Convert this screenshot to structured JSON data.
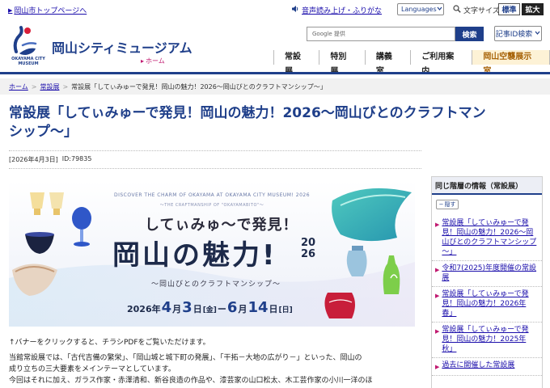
{
  "utility": {
    "home_link": "岡山市トップページへ",
    "voice_link": "音声読み上げ・ふりがな",
    "languages": "Languages",
    "font_size_label": "文字サイズ",
    "font_normal": "標準",
    "font_large": "拡大"
  },
  "header": {
    "logo_sub": "OKAYAMA CITY MUSEUM",
    "site_title": "岡山シティミュージアム",
    "site_home": "ホーム",
    "search_placeholder": "Google 提供",
    "search_button": "検索",
    "id_search": "記事ID検索"
  },
  "gnav": [
    "常設展",
    "特別展",
    "講義室",
    "ご利用案内",
    "岡山空襲展示室"
  ],
  "breadcrumb": {
    "home": "ホーム",
    "parent": "常設展",
    "current": "常設展「してぃみゅーで発見！岡山の魅力！2026～岡山びとのクラフトマンシップ～」"
  },
  "page": {
    "title_line1": "常設展「してぃみゅーで発見！岡山の魅力！2026～岡山びとのクラフトマン",
    "title_line2": "シップ～」",
    "date": "[2026年4月3日]",
    "id": "ID:79835"
  },
  "banner": {
    "top_text": "DISCOVER THE CHARM OF OKAYAMA AT OKAYAMA CITY MUSEUM! 2026",
    "sub_text": "～THE CRAFTMANSHIP OF \"OKAYAMABITO\"～",
    "catch": "してぃみゅ～で発見！",
    "main": "岡山の魅力!",
    "year_a": "20",
    "year_b": "26",
    "craft": "～岡山びとのクラフトマンシップ～",
    "date_year": "2026年",
    "date_m1": "4",
    "date_mu1": "月",
    "date_d1": "3",
    "date_du1": "日",
    "date_dow1": "[金]",
    "date_dash": "ー",
    "date_m2": "6",
    "date_mu2": "月",
    "date_d2": "14",
    "date_du2": "日",
    "date_dow2": "[日]"
  },
  "content": {
    "caption": "↑バナーをクリックすると、チラシPDFをご覧いただけます。",
    "p1": "当館常設展では、「古代吉備の繁栄」、「岡山城と城下町の発展」、「干拓－大地の広がり－」といった、岡山の",
    "p2": "成り立ちの三大要素をメインテーマとしています。",
    "p3": "今回はそれに加え、ガラス作家・赤澤清和、新谷良造の作品や、漆芸家の山口松太、木工芸作家の小川一洋のほ"
  },
  "sidebar": {
    "heading": "同じ階層の情報（常設展）",
    "toggle": "隠す",
    "items": [
      "常設展「してぃみゅーで発見！岡山の魅力！2026～岡山びとのクラフトマンシップ～」",
      "令和7(2025)年度開催の常設展",
      "常設展「してぃみゅーで発見！岡山の魅力！2026年 春」",
      "常設展「してぃみゅーで発見！岡山の魅力！2025年 秋」",
      "過去に開催した常設展"
    ]
  },
  "colors": {
    "navy": "#1f3f8a",
    "accent_pink": "#c0186f",
    "link": "#1a0dab"
  }
}
